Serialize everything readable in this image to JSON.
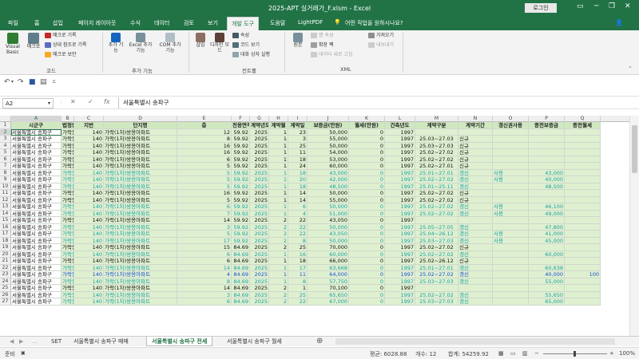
{
  "window": {
    "title": "2025-APT 실거래가_F.xlsm  -  Excel",
    "login": "로그인",
    "controls": [
      "─",
      "❐",
      "✕"
    ]
  },
  "tabs": [
    "파일",
    "홈",
    "삽입",
    "페이지 레이아웃",
    "수식",
    "데이터",
    "검토",
    "보기",
    "개발 도구",
    "도움말",
    "LightPDF"
  ],
  "active_tab": "개발 도구",
  "tell_me": "어떤 작업을 원하시나요?",
  "ribbon": {
    "code": {
      "label": "코드",
      "visual_basic": "Visual Basic",
      "macro": "매크로",
      "record": "매크로 기록",
      "relative": "상대 참조로 기록",
      "security": "매크로 보안"
    },
    "addins": {
      "label": "추가 기능",
      "addin": "추가 기능",
      "excel_addin": "Excel 추가 기능",
      "com_addin": "COM 추가 기능"
    },
    "controls": {
      "label": "컨트롤",
      "insert": "삽입",
      "design_mode": "디자인 모드",
      "properties": "속성",
      "view_code": "코드 보기",
      "run_dialog": "대화 상자 실행"
    },
    "xml": {
      "label": "XML",
      "source": "원본",
      "map_props": "맵 속성",
      "expansion": "확장 팩",
      "refresh": "데이터 새로 고침",
      "import": "가져오기",
      "export": "내보내기"
    }
  },
  "formula_bar": {
    "name_box": "A2",
    "cancel": "✕",
    "enter": "✓",
    "fx": "fx",
    "content": "서울특별시 송파구"
  },
  "columns": [
    "A",
    "B",
    "C",
    "D",
    "E",
    "F",
    "G",
    "H",
    "I",
    "J",
    "K",
    "L",
    "M",
    "N",
    "O",
    "P",
    "Q"
  ],
  "headers": [
    "시군구",
    "법정동",
    "지번",
    "단지명",
    "층",
    "전용면적",
    "계약년도",
    "계약월",
    "계약일",
    "보증금(만원)",
    "월세(만원)",
    "건축년도",
    "계약구분",
    "계약기간",
    "갱신권사용",
    "종전보증금",
    "종전월세"
  ],
  "rows": [
    {
      "n": "2",
      "v": [
        "서울특별시 송파구",
        "가락동",
        "140",
        "가락(1차)쌍용아파트",
        "12",
        "59.92",
        "2025",
        "1",
        "23",
        "50,000",
        "0",
        "1997",
        "",
        "",
        "",
        "",
        ""
      ],
      "s": "g"
    },
    {
      "n": "3",
      "v": [
        "서울특별시 송파구",
        "가락동",
        "140",
        "가락(1차)쌍용아파트",
        "8",
        "59.92",
        "2025",
        "1",
        "3",
        "55,000",
        "0",
        "1997",
        "25.03~27.03",
        "신규",
        "",
        "",
        ""
      ],
      "s": "g"
    },
    {
      "n": "4",
      "v": [
        "서울특별시 송파구",
        "가락동",
        "140",
        "가락(1차)쌍용아파트",
        "16",
        "59.92",
        "2025",
        "1",
        "25",
        "50,000",
        "0",
        "1997",
        "25.03~27.03",
        "신규",
        "",
        "",
        ""
      ],
      "s": "g"
    },
    {
      "n": "5",
      "v": [
        "서울특별시 송파구",
        "가락동",
        "140",
        "가락(1차)쌍용아파트",
        "16",
        "59.92",
        "2025",
        "1",
        "11",
        "54,000",
        "0",
        "1997",
        "25.02~27.02",
        "신규",
        "",
        "",
        ""
      ],
      "s": "g"
    },
    {
      "n": "6",
      "v": [
        "서울특별시 송파구",
        "가락동",
        "140",
        "가락(1차)쌍용아파트",
        "6",
        "59.92",
        "2025",
        "1",
        "18",
        "53,000",
        "0",
        "1997",
        "25.02~27.02",
        "신규",
        "",
        "",
        ""
      ],
      "s": "g"
    },
    {
      "n": "7",
      "v": [
        "서울특별시 송파구",
        "가락동",
        "140",
        "가락(1차)쌍용아파트",
        "5",
        "59.92",
        "2025",
        "1",
        "24",
        "60,000",
        "0",
        "1997",
        "25.02~27.01",
        "신규",
        "",
        "",
        ""
      ],
      "s": "g"
    },
    {
      "n": "8",
      "v": [
        "서울특별시 송파구",
        "가락동",
        "140",
        "가락(1차)쌍용아파트",
        "5",
        "59.92",
        "2025",
        "1",
        "18",
        "43,000",
        "0",
        "1997",
        "25.01~27.01",
        "갱신",
        "사용",
        "43,000",
        ""
      ],
      "s": "t"
    },
    {
      "n": "9",
      "v": [
        "서울특별시 송파구",
        "가락동",
        "140",
        "가락(1차)쌍용아파트",
        "5",
        "59.92",
        "2025",
        "1",
        "20",
        "42,000",
        "0",
        "1997",
        "25.02~27.02",
        "갱신",
        "사용",
        "40,000",
        ""
      ],
      "s": "t"
    },
    {
      "n": "10",
      "v": [
        "서울특별시 송파구",
        "가락동",
        "140",
        "가락(1차)쌍용아파트",
        "5",
        "59.92",
        "2025",
        "1",
        "18",
        "48,500",
        "0",
        "1997",
        "25.01~25.11",
        "갱신",
        "",
        "48,500",
        ""
      ],
      "s": "t"
    },
    {
      "n": "11",
      "v": [
        "서울특별시 송파구",
        "가락동",
        "140",
        "가락(1차)쌍용아파트",
        "16",
        "59.92",
        "2025",
        "1",
        "14",
        "50,000",
        "0",
        "1997",
        "25.02~27.02",
        "신규",
        "",
        "",
        ""
      ],
      "s": "g"
    },
    {
      "n": "12",
      "v": [
        "서울특별시 송파구",
        "가락동",
        "140",
        "가락(1차)쌍용아파트",
        "5",
        "59.92",
        "2025",
        "1",
        "14",
        "55,000",
        "0",
        "1997",
        "25.02~27.02",
        "신규",
        "",
        "",
        ""
      ],
      "s": "g"
    },
    {
      "n": "13",
      "v": [
        "서울특별시 송파구",
        "가락동",
        "140",
        "가락(1차)쌍용아파트",
        "6",
        "59.92",
        "2025",
        "1",
        "6",
        "50,000",
        "0",
        "1997",
        "25.02~27.02",
        "갱신",
        "사용",
        "46,100",
        ""
      ],
      "s": "t"
    },
    {
      "n": "14",
      "v": [
        "서울특별시 송파구",
        "가락동",
        "140",
        "가락(1차)쌍용아파트",
        "7",
        "59.92",
        "2025",
        "1",
        "4",
        "51,000",
        "0",
        "1997",
        "25.02~27.02",
        "갱신",
        "사용",
        "49,000",
        ""
      ],
      "s": "t"
    },
    {
      "n": "15",
      "v": [
        "서울특별시 송파구",
        "가락동",
        "140",
        "가락(1차)쌍용아파트",
        "14",
        "59.92",
        "2025",
        "2",
        "22",
        "43,050",
        "0",
        "1997",
        "",
        "",
        "",
        "",
        ""
      ],
      "s": "g"
    },
    {
      "n": "16",
      "v": [
        "서울특별시 송파구",
        "가락동",
        "140",
        "가락(1차)쌍용아파트",
        "3",
        "59.92",
        "2025",
        "2",
        "22",
        "50,000",
        "0",
        "1997",
        "25.05~27.05",
        "갱신",
        "",
        "47,800",
        ""
      ],
      "s": "t"
    },
    {
      "n": "17",
      "v": [
        "서울특별시 송파구",
        "가락동",
        "140",
        "가락(1차)쌍용아파트",
        "5",
        "59.92",
        "2025",
        "2",
        "22",
        "43,050",
        "0",
        "1997",
        "25.04~26.12",
        "갱신",
        "사용",
        "41,000",
        ""
      ],
      "s": "t"
    },
    {
      "n": "18",
      "v": [
        "서울특별시 송파구",
        "가락동",
        "140",
        "가락(1차)쌍용아파트",
        "17",
        "59.92",
        "2025",
        "2",
        "8",
        "50,000",
        "0",
        "1997",
        "25.03~27.03",
        "갱신",
        "사용",
        "45,000",
        ""
      ],
      "s": "t"
    },
    {
      "n": "19",
      "v": [
        "서울특별시 송파구",
        "가락동",
        "140",
        "가락(1차)쌍용아파트",
        "15",
        "84.69",
        "2025",
        "2",
        "25",
        "70,000",
        "0",
        "1997",
        "25.02~27.02",
        "신규",
        "",
        "",
        ""
      ],
      "s": "g"
    },
    {
      "n": "20",
      "v": [
        "서울특별시 송파구",
        "가락동",
        "140",
        "가락(1차)쌍용아파트",
        "6",
        "84.69",
        "2025",
        "1",
        "16",
        "60,000",
        "0",
        "1997",
        "25.02~27.02",
        "갱신",
        "",
        "60,000",
        ""
      ],
      "s": "t"
    },
    {
      "n": "21",
      "v": [
        "서울특별시 송파구",
        "가락동",
        "140",
        "가락(1차)쌍용아파트",
        "6",
        "84.69",
        "2025",
        "1",
        "18",
        "66,000",
        "0",
        "1997",
        "25.02~26.12",
        "신규",
        "",
        "",
        ""
      ],
      "s": "g"
    },
    {
      "n": "22",
      "v": [
        "서울특별시 송파구",
        "가락동",
        "140",
        "가락(1차)쌍용아파트",
        "14",
        "84.69",
        "2025",
        "1",
        "17",
        "63,668",
        "0",
        "1997",
        "25.01~27.01",
        "갱신",
        "",
        "60,638",
        ""
      ],
      "s": "t"
    },
    {
      "n": "23",
      "v": [
        "서울특별시 송파구",
        "가락동",
        "140",
        "가락(1차)쌍용아파트",
        "4",
        "84.69",
        "2025",
        "1",
        "11",
        "64,000",
        "0",
        "1997",
        "25.02~27.02",
        "갱신",
        "",
        "40,000",
        "100"
      ],
      "s": "b"
    },
    {
      "n": "24",
      "v": [
        "서울특별시 송파구",
        "가락동",
        "140",
        "가락(1차)쌍용아파트",
        "8",
        "84.69",
        "2025",
        "1",
        "8",
        "57,750",
        "0",
        "1997",
        "25.03~27.03",
        "갱신",
        "",
        "55,000",
        ""
      ],
      "s": "t"
    },
    {
      "n": "25",
      "v": [
        "서울특별시 송파구",
        "가락동",
        "140",
        "가락(1차)쌍용아파트",
        "14",
        "84.69",
        "2025",
        "2",
        "1",
        "70,100",
        "0",
        "1997",
        "",
        "",
        "",
        "",
        ""
      ],
      "s": "g"
    },
    {
      "n": "26",
      "v": [
        "서울특별시 송파구",
        "가락동",
        "140",
        "가락(1차)쌍용아파트",
        "3",
        "84.69",
        "2025",
        "2",
        "25",
        "65,650",
        "0",
        "1997",
        "25.02~27.02",
        "갱신",
        "",
        "55,650",
        ""
      ],
      "s": "t"
    },
    {
      "n": "27",
      "v": [
        "서울특별시 송파구",
        "가락동",
        "140",
        "가락(1차)쌍용아파트",
        "6",
        "84.69",
        "2025",
        "2",
        "22",
        "67,000",
        "0",
        "1997",
        "25.03~27.03",
        "갱신",
        "",
        "65,000",
        ""
      ],
      "s": "t"
    }
  ],
  "sheets": [
    "SET",
    "서울특별시 송파구 매매",
    "서울특별시 송파구 전세",
    "서울특별시 송파구 월세"
  ],
  "active_sheet": "서울특별시 송파구 전세",
  "status": {
    "mode": "준비",
    "average": "평균: 6028.88",
    "count": "개수: 12",
    "sum": "합계: 54259.92",
    "zoom": "100%"
  },
  "colors": {
    "brand": "#217346",
    "row_green": "#dff0d0",
    "row_teal_text": "#1aa2a0",
    "row_blue_text": "#1a4fd0",
    "header_fill": "#cfe8c0"
  }
}
